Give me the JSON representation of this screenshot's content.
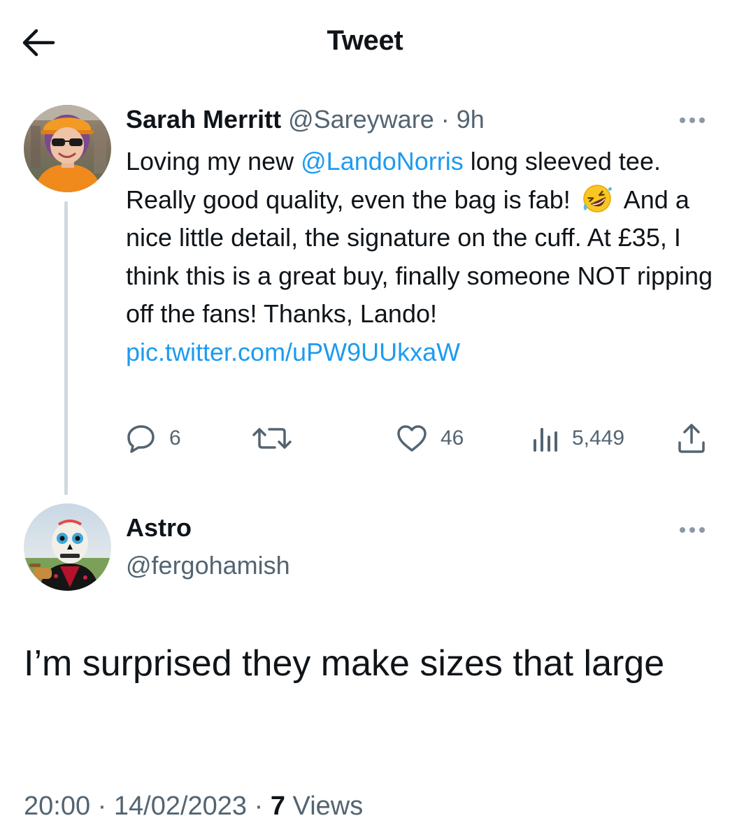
{
  "header": {
    "title": "Tweet",
    "back_icon": "arrow-left-icon"
  },
  "parent_tweet": {
    "display_name": "Sarah Merritt",
    "handle": "@Sareyware",
    "separator": "·",
    "time": "9h",
    "text_1": "Loving my new ",
    "mention": "@LandoNorris",
    "text_2": " long sleeved tee. Really good quality, even the bag is fab! ",
    "emoji": "🤣",
    "text_3": " And a nice little detail, the signature on the cuff. At £35, I think this is a great buy, finally someone NOT ripping off the fans! Thanks, Lando!",
    "link": "pic.twitter.com/uPW9UUkxaW",
    "actions": {
      "reply_count": "6",
      "retweet_count": "",
      "like_count": "46",
      "views_count": "5,449"
    }
  },
  "reply_tweet": {
    "display_name": "Astro",
    "handle": "@fergohamish",
    "text": "I’m surprised they make sizes that large",
    "time": "20:00",
    "sep_1": "·",
    "date": "14/02/2023",
    "sep_2": "·",
    "views_count": "7",
    "views_label": "Views"
  },
  "colors": {
    "text": "#0f1419",
    "secondary": "#536471",
    "link": "#1d9bf0",
    "thread_line": "#cfd9de"
  }
}
